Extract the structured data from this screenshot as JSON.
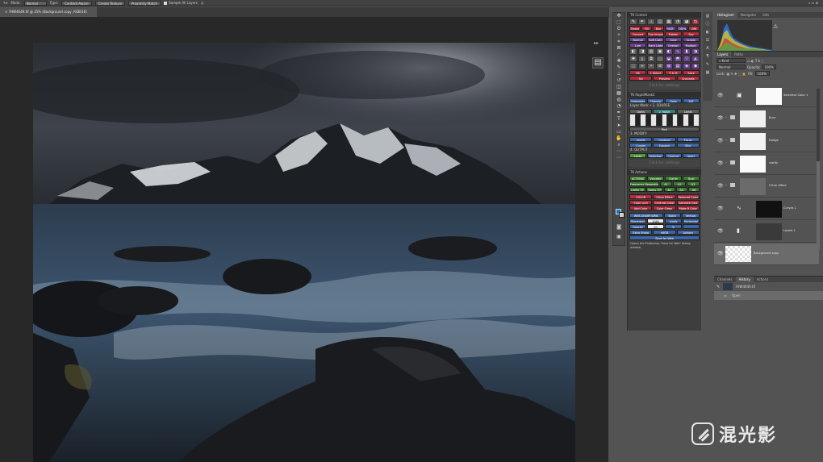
{
  "options_bar": {
    "mode_label": "Mode:",
    "mode_value": "Normal",
    "type_label": "Type:",
    "buttons": [
      "Content-Aware",
      "Create Texture",
      "Proximity Match"
    ],
    "sample_all_layers": "Sample All Layers"
  },
  "document": {
    "tab_title": "7HW4649.tif @ 25% (Background copy, RGB/16)"
  },
  "tk_control": {
    "title": "TK Control",
    "row1": [
      "Stroke",
      "Fill",
      "Blur",
      "NCR",
      "100%",
      "Dflt"
    ],
    "row2": [
      "Convert",
      "Dup Image",
      "Flatten",
      "Sav"
    ],
    "row3": [
      "Normal",
      "Soft Light",
      "Color",
      "Screen"
    ],
    "row4": [
      "Lum",
      "Hard Light",
      "Overlay",
      "Multiply"
    ],
    "row5": [
      "SB",
      "1 Select",
      "S & M",
      "Save"
    ],
    "row6": [
      "Sel",
      "Preview",
      "Channels"
    ],
    "placeholder": "Click for settings"
  },
  "tk_rapidmask": {
    "title": "TK RapidMask2",
    "row1": [
      "Composite",
      "Channel",
      "Color",
      "SAT"
    ],
    "source_label": "Layer Mask • 1. SOURCE",
    "mask_label": "2. MASK",
    "mask_value": "Lights",
    "dark_label": "Darks",
    "pick_label": "Pick",
    "modify_label": "3. MODIFY",
    "modify_row1": [
      "Levels",
      "Contract",
      "Focus"
    ],
    "modify_row2": [
      "Curves",
      "Expand",
      "Blur"
    ],
    "output_label": "4. OUTPUT",
    "output_row": [
      "Layer",
      "Selection",
      "Channel",
      "Apply"
    ],
    "placeholder": "Click for settings"
  },
  "tk_actions": {
    "title": "TK Actions",
    "actions_label": "ACTIONS",
    "actions_row1": [
      "Vignette",
      "Clarity",
      "Dual"
    ],
    "actions_row2": [
      "Frequency Separation",
      "A1",
      "A2",
      "A3"
    ],
    "actions_row3": [
      "Lights T/F",
      "Darks T/F",
      "A4",
      "A5",
      "A6"
    ],
    "color_label": "COLOR",
    "color_row1": [
      "Orton Effect",
      "Reduced Color"
    ],
    "color_row2": [
      "Color Lum",
      "Contrast Color",
      "Saturate Cast"
    ],
    "color_row3": [
      "Add Color",
      "Color Clean",
      "Make B Color"
    ],
    "web_label": "WEB-SHARP-WMK",
    "web_buttons": [
      "Batch",
      "Vertical"
    ],
    "dimension_label": "Dimension",
    "dimension_value": "1080",
    "pixels_label": "pixels",
    "horizontal_label": "Horizontal",
    "opacity_label": "Opacity",
    "opacity_value": "50",
    "percent_label": "%",
    "extra_sharp": "Extra Sharp",
    "srgb_label": "sRGB",
    "actions_chk": "Actions",
    "save_web": "Save for Web",
    "help_text": "Opens the Photoshop \"Save for Web\" dialog window."
  },
  "histogram": {
    "tabs": [
      "Histogram",
      "Navigator",
      "Info"
    ]
  },
  "layers": {
    "tabs": [
      "Layers",
      "Paths"
    ],
    "kind_label": "Kind",
    "blend_mode": "Normal",
    "opacity_label": "Opacity:",
    "opacity_value": "100%",
    "lock_label": "Lock:",
    "fill_label": "Fill:",
    "fill_value": "100%",
    "items": [
      "Selective Color 1",
      "Burn",
      "Dodge",
      "clarity",
      "Orton effect",
      "Curves 1",
      "Levels 1",
      "Background copy"
    ]
  },
  "history": {
    "tabs": [
      "Channels",
      "History",
      "Actions"
    ],
    "snapshot": "7HW4649.tif",
    "step": "Open"
  },
  "watermark": {
    "text": "混光影"
  },
  "colors": {
    "foreground": "#0d7bd6",
    "accent_red": "#b8293a",
    "accent_purple": "#6d3f95",
    "accent_green": "#4a9a32"
  }
}
